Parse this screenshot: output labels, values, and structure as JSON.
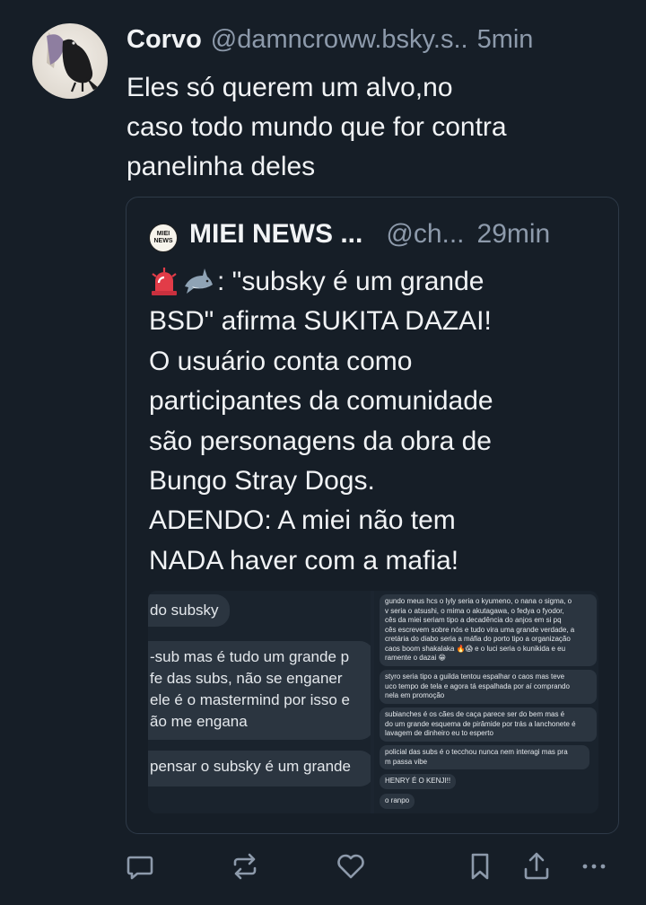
{
  "post": {
    "author": {
      "name": "Corvo",
      "handle": "@damncroww.bsky.s..",
      "time": "5min"
    },
    "text_lines": [
      "Eles só querem um alvo,no",
      "caso todo mundo que for contra",
      "panelinha deles"
    ]
  },
  "quote": {
    "avatar_lines": [
      "MIEI",
      "NEWS"
    ],
    "author": {
      "name": "MIEI NEWS ...",
      "handle": "@ch...",
      "time": "29min"
    },
    "emojis": [
      "siren-icon",
      "shark-icon"
    ],
    "first_line_text": ": \"subsky é um grande",
    "text_lines": [
      "BSD\" afirma SUKITA DAZAI!",
      "O usuário conta como",
      "participantes da comunidade",
      "são personagens da obra de",
      "Bungo Stray Dogs.",
      "ADENDO: A miei não tem",
      "NADA haver com a mafia!"
    ],
    "image": {
      "left_bubbles": [
        "do subsky",
        "-sub mas é tudo um grande p",
        "fe das subs, não se enganer",
        "ele é o mastermind por isso e",
        "ão me engana",
        "pensar o subsky é um grande"
      ],
      "right_bubbles": [
        [
          "gundo meus hcs o lyly seria o kyumeno, o nana o sigma, o",
          "v seria o atsushi, o mima o akutagawa, o fedya o fyodor,",
          "cês da miei seriam tipo a decadência do anjos em si pq",
          "cês escrevem sobre nós e tudo vira uma grande verdade, a",
          "cretária do diabo seria a máfia do porto tipo a organização",
          "caos boom shakalaka 🔥😱 e o luci seria o kunikida e eu",
          "ramente o dazai 😁"
        ],
        [
          "styro seria tipo a guilda tentou espalhar o caos mas teve",
          "uco tempo de tela e agora tá espalhada por aí comprando",
          "nela em promoção"
        ],
        [
          "subianches é os cães de caça parece ser do bem mas é",
          "do um grande esquema de pirâmide por trás a lanchonete é",
          "lavagem de dinheiro eu to esperto"
        ],
        [
          "policial das subs é o tecchou nunca nem interagi mas pra",
          "m passa vibe"
        ],
        [
          "HENRY É O KENJI!!"
        ],
        [
          "o ranpo"
        ]
      ]
    }
  },
  "actions": [
    "reply-icon",
    "repost-icon",
    "like-icon",
    "bookmark-icon",
    "share-icon",
    "more-icon"
  ]
}
